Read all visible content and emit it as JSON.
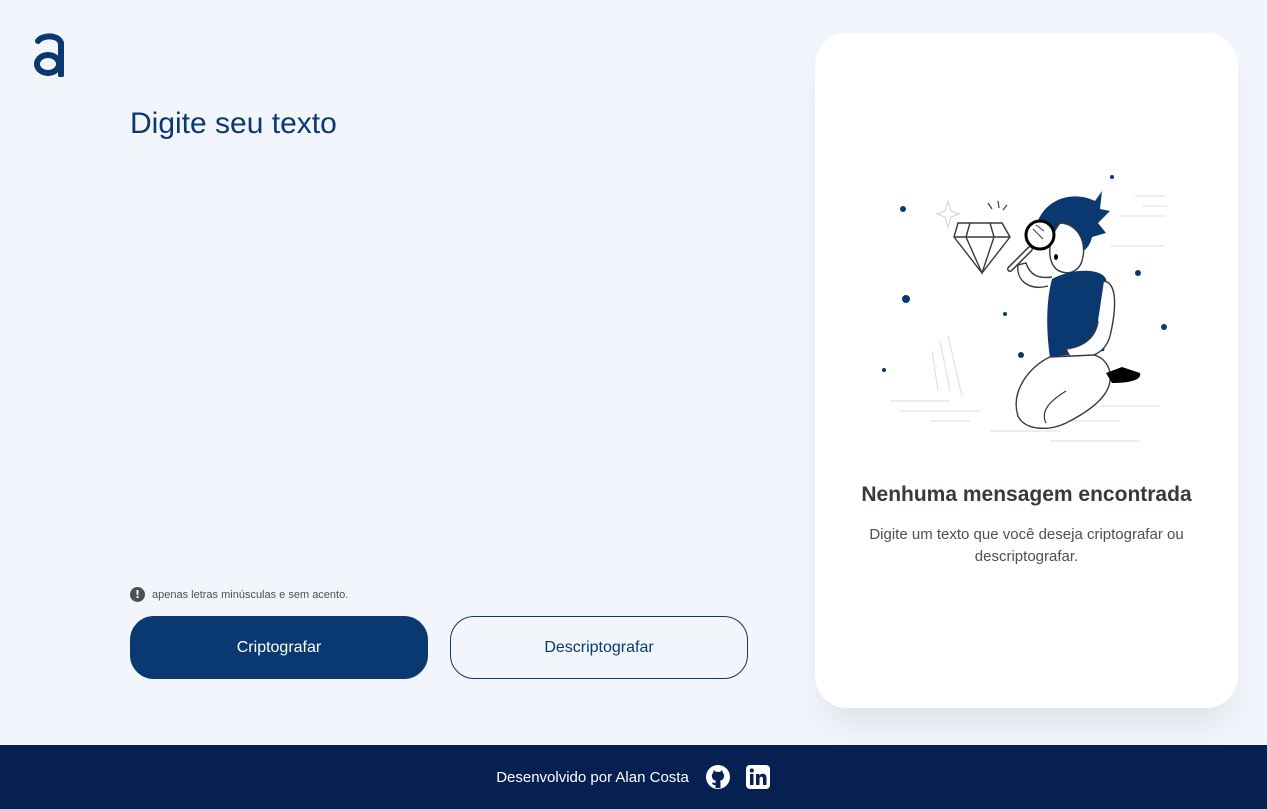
{
  "app": {
    "logo_icon": "alura-a-logo-icon",
    "brand_color": "#0a3871"
  },
  "main": {
    "placeholder": "Digite seu texto",
    "hint_icon": "exclamation-circle-icon",
    "hint_text": "apenas letras minúsculas e sem acento.",
    "encrypt_label": "Criptografar",
    "decrypt_label": "Descriptografar"
  },
  "panel": {
    "illustration": "person-with-magnifying-glass-illustration",
    "title": "Nenhuma mensagem encontrada",
    "text": "Digite um texto que você deseja criptografar ou descriptografar."
  },
  "footer": {
    "credit": "Desenvolvido por Alan Costa",
    "github_icon": "github-icon",
    "linkedin_icon": "linkedin-icon",
    "background": "#052051"
  }
}
